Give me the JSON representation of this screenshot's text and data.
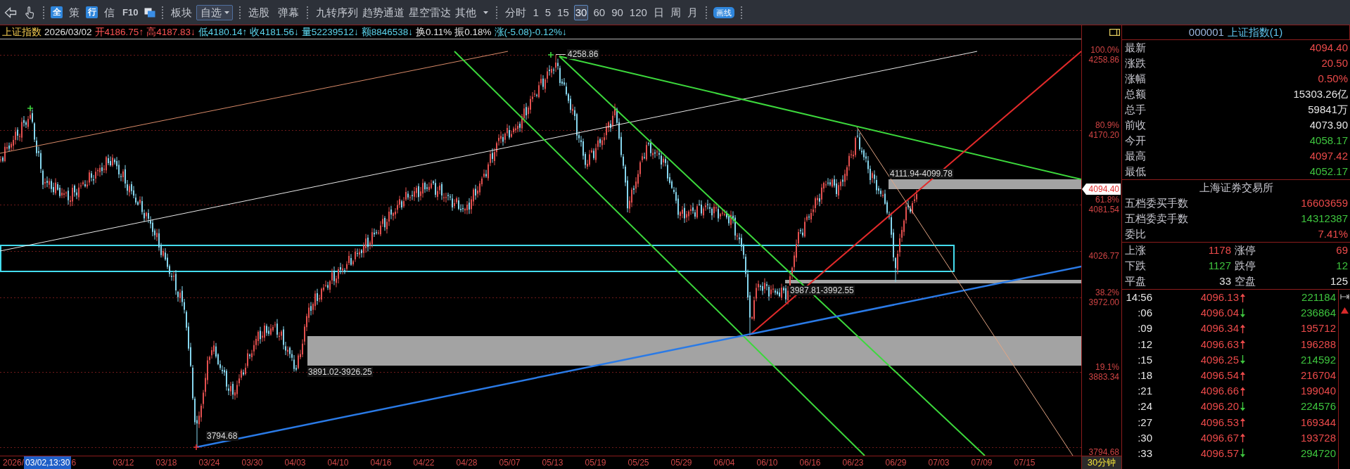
{
  "toolbar": {
    "quick": [
      {
        "label": "全",
        "kind": "badge"
      },
      {
        "label": "策",
        "kind": "plain"
      },
      {
        "label": "行",
        "kind": "badge"
      },
      {
        "label": "信",
        "kind": "plain"
      },
      {
        "label": "F10",
        "kind": "bold"
      }
    ],
    "menus": [
      {
        "label": "板块",
        "kind": "plain"
      },
      {
        "label": "自选",
        "kind": "select"
      }
    ],
    "tools": [
      {
        "label": "选股"
      },
      {
        "label": "弹幕"
      }
    ],
    "indicators": [
      {
        "label": "九转序列",
        "kind": "plain"
      },
      {
        "label": "趋势通道",
        "kind": "plain"
      },
      {
        "label": "星空雷达",
        "kind": "plain"
      },
      {
        "label": "其他",
        "kind": "more"
      }
    ],
    "periods": [
      {
        "label": "分时",
        "selected": false
      },
      {
        "label": "1",
        "selected": false
      },
      {
        "label": "5",
        "selected": false
      },
      {
        "label": "15",
        "selected": false
      },
      {
        "label": "30",
        "selected": true
      },
      {
        "label": "60",
        "selected": false
      },
      {
        "label": "90",
        "selected": false
      },
      {
        "label": "120",
        "selected": false
      },
      {
        "label": "日",
        "selected": false
      },
      {
        "label": "周",
        "selected": false
      },
      {
        "label": "月",
        "selected": false
      }
    ],
    "draw_button": "画线"
  },
  "info_bar": [
    {
      "text": "上证指数",
      "color": "#f0c850"
    },
    {
      "text": "2026/03/02",
      "color": "#e4e4e4"
    },
    {
      "text": "开4186.75↑",
      "color": "#ff5454"
    },
    {
      "text": "高4187.83↓",
      "color": "#ff5454"
    },
    {
      "text": "低4180.14↑",
      "color": "#5cd6ee"
    },
    {
      "text": "收4181.56↓",
      "color": "#5cd6ee"
    },
    {
      "text": "量52239512↓",
      "color": "#5cd6ee"
    },
    {
      "text": "额8846538↓",
      "color": "#5cd6ee"
    },
    {
      "text": "换0.11%",
      "color": "#e4e4e4"
    },
    {
      "text": "振0.18%",
      "color": "#e4e4e4"
    },
    {
      "text": "涨(-5.08)-0.12%↓",
      "color": "#5cd6ee"
    }
  ],
  "chart": {
    "annotations": [
      "4258.86",
      "4111.94-4099.78",
      "3987.81-3992.55",
      "3891.02-3926.25",
      "3794.68"
    ],
    "price_axis": {
      "levels": [
        {
          "percent": "100.0%",
          "price": "4258.86"
        },
        {
          "percent": "80.9%",
          "price": "4170.20"
        },
        {
          "percent": "61.8%",
          "price": "4081.54"
        },
        {
          "price": "4026.77"
        },
        {
          "percent": "38.2%",
          "price": "3972.00"
        },
        {
          "percent": "19.1%",
          "price": "3883.34"
        },
        {
          "price": "3794.68"
        }
      ],
      "last_price": "4094.40"
    },
    "date_axis": {
      "year": "2026/",
      "cursor": "03/02,13:30",
      "cut_label": "6",
      "dates": [
        "03/12",
        "03/18",
        "03/24",
        "03/30",
        "04/03",
        "04/10",
        "04/16",
        "04/22",
        "04/28",
        "05/07",
        "05/13",
        "05/19",
        "05/25",
        "05/29",
        "06/04",
        "06/10",
        "06/16",
        "06/23",
        "06/29",
        "07/03",
        "07/09",
        "07/15"
      ]
    },
    "period": "30分钟"
  },
  "quote_panel": {
    "code": "000001",
    "name": "上证指数(1)",
    "quotes": [
      {
        "label": "最新",
        "value": "4094.40",
        "color": "#ec4a4a"
      },
      {
        "label": "涨跌",
        "value": "20.50",
        "color": "#ec4a4a"
      },
      {
        "label": "涨幅",
        "value": "0.50%",
        "color": "#ec4a4a"
      },
      {
        "label": "总额",
        "value": "15303.26亿",
        "color": "#e6e6e6"
      },
      {
        "label": "总手",
        "value": "59841万",
        "color": "#e6e6e6"
      },
      {
        "label": "前收",
        "value": "4073.90",
        "color": "#e6e6e6"
      },
      {
        "label": "今开",
        "value": "4058.17",
        "color": "#3ec43e"
      },
      {
        "label": "最高",
        "value": "4097.42",
        "color": "#ec4a4a"
      },
      {
        "label": "最低",
        "value": "4052.17",
        "color": "#3ec43e"
      }
    ],
    "exchange": {
      "title": "上海证券交易所",
      "rows": [
        {
          "label": "五档委买手数",
          "value": "16603659",
          "color": "#ec4a4a"
        },
        {
          "label": "五档委卖手数",
          "value": "14312387",
          "color": "#3ec43e"
        },
        {
          "label": "委比",
          "value": "7.41%",
          "color": "#ec4a4a"
        }
      ]
    },
    "breadth": [
      {
        "label": "上涨",
        "count": "1178",
        "limit_label": "涨停",
        "limit_count": "69",
        "color": "#ec4a4a"
      },
      {
        "label": "下跌",
        "count": "1127",
        "limit_label": "跌停",
        "limit_count": "12",
        "color": "#3ec43e"
      },
      {
        "label": "平盘",
        "count": "33",
        "limit_label": "空盘",
        "limit_count": "125",
        "color": "#e6e6e6"
      }
    ],
    "ticks": [
      {
        "time": "14:56",
        "price": "4096.13",
        "kind": "up",
        "volume": "221184",
        "color": "#3ec43e"
      },
      {
        "time": ":06",
        "price": "4096.04",
        "kind": "down",
        "volume": "236864",
        "color": "#3ec43e"
      },
      {
        "time": ":09",
        "price": "4096.34",
        "kind": "up",
        "volume": "195712",
        "color": "#ec4a4a"
      },
      {
        "time": ":12",
        "price": "4096.63",
        "kind": "up",
        "volume": "196288",
        "color": "#ec4a4a"
      },
      {
        "time": ":15",
        "price": "4096.25",
        "kind": "down",
        "volume": "214592",
        "color": "#3ec43e"
      },
      {
        "time": ":18",
        "price": "4096.54",
        "kind": "up",
        "volume": "216704",
        "color": "#ec4a4a"
      },
      {
        "time": ":21",
        "price": "4096.66",
        "kind": "up",
        "volume": "199040",
        "color": "#ec4a4a"
      },
      {
        "time": ":24",
        "price": "4096.20",
        "kind": "down",
        "volume": "224576",
        "color": "#3ec43e"
      },
      {
        "time": ":27",
        "price": "4096.53",
        "kind": "up",
        "volume": "169344",
        "color": "#ec4a4a"
      },
      {
        "time": ":30",
        "price": "4096.67",
        "kind": "up",
        "volume": "193728",
        "color": "#ec4a4a"
      },
      {
        "time": ":33",
        "price": "4096.57",
        "kind": "down",
        "volume": "294720",
        "color": "#3ec43e"
      }
    ]
  }
}
